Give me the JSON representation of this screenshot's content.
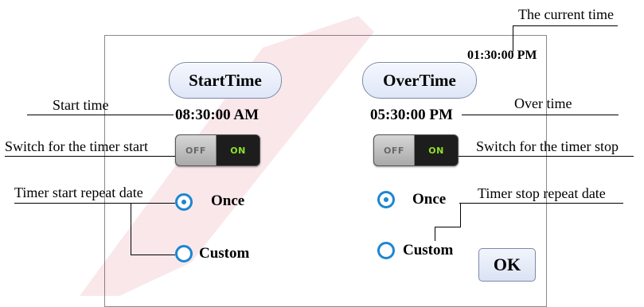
{
  "annotations": {
    "current_time": "The current time",
    "start_time": "Start time",
    "over_time": "Over time",
    "switch_start": "Switch for the timer start",
    "switch_stop": "Switch for the timer stop",
    "repeat_start": "Timer start repeat date",
    "repeat_stop": "Timer stop repeat date"
  },
  "screen": {
    "current_time": "01:30:00 PM",
    "start_title": "StartTime",
    "over_title": "OverTime",
    "start_time_value": "08:30:00 AM",
    "over_time_value": "05:30:00 PM",
    "start_toggle": {
      "off_label": "OFF",
      "on_label": "ON"
    },
    "stop_toggle": {
      "off_label": "OFF",
      "on_label": "ON"
    },
    "start_repeat": {
      "once_label": "Once",
      "custom_label": "Custom",
      "selected": "Once"
    },
    "stop_repeat": {
      "once_label": "Once",
      "custom_label": "Custom",
      "selected": "Once"
    },
    "ok_label": "OK"
  },
  "colors": {
    "radio_blue": "#1e86d0",
    "toggle_on_text": "#8ee02a",
    "watermark": "#c8102e"
  }
}
